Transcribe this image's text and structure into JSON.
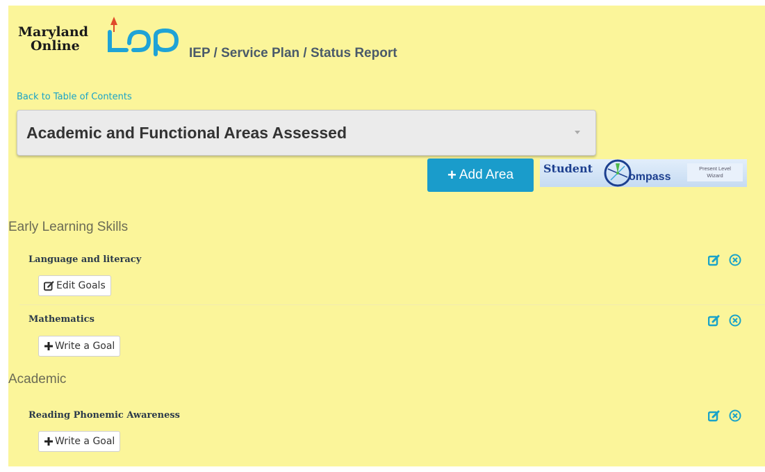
{
  "logo": {
    "line1": "Maryland",
    "line2": "Online",
    "brand_color": "#1fa3d6",
    "accent": "#e04a2a"
  },
  "app_title": "IEP / Service Plan / Status Report",
  "back_link": "Back to Table of Contents",
  "area_select": {
    "selected": "Academic and Functional Areas Assessed"
  },
  "add_area_button": {
    "icon": "+",
    "label": "Add Area"
  },
  "student_compass": {
    "word1": "Student",
    "word2": "ompass",
    "wizard_line1": "Present Level",
    "wizard_line2": "Wizard"
  },
  "categories": [
    {
      "title": "Early Learning Skills",
      "areas": [
        {
          "name": "Language and literacy",
          "button_icon": "edit-icon",
          "button_label": "Edit Goals"
        },
        {
          "name": "Mathematics",
          "button_icon": "plus-icon",
          "button_label": "Write a Goal"
        }
      ]
    },
    {
      "title": "Academic",
      "areas": [
        {
          "name": "Reading Phonemic Awareness",
          "button_icon": "plus-icon",
          "button_label": "Write a Goal"
        }
      ]
    }
  ],
  "colors": {
    "panel_bg": "#fbf59a",
    "primary": "#1a9ccb",
    "icon": "#1aa3c8"
  }
}
